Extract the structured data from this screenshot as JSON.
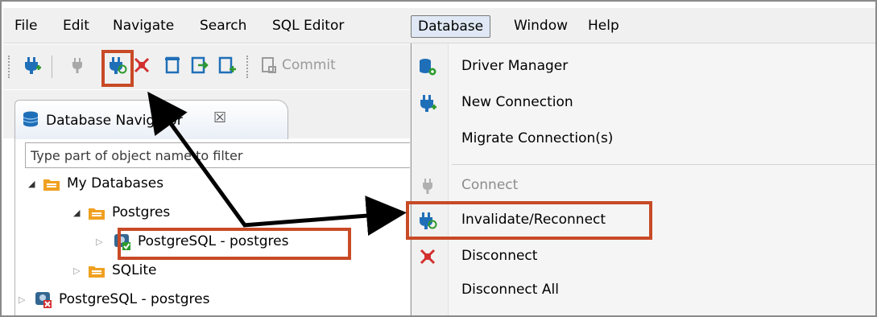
{
  "menubar": {
    "items": [
      "File",
      "Edit",
      "Navigate",
      "Search",
      "SQL Editor",
      "Database",
      "Window",
      "Help"
    ],
    "active": "Database"
  },
  "toolbar": {
    "commit_label": "Commit",
    "icons": [
      "new-connection-icon",
      "connect-icon",
      "invalidate-reconnect-icon",
      "disconnect-icon",
      "transaction-icon",
      "open-editor-icon",
      "new-editor-icon",
      "commit-icon"
    ]
  },
  "navigator": {
    "tab_label": "Database Navigator",
    "tab_close": "☒",
    "filter_placeholder": "Type part of object name to filter",
    "tree": {
      "my_databases": "My Databases",
      "postgres_folder": "Postgres",
      "postgres_conn": "PostgreSQL - postgres",
      "sqlite_folder": "SQLite",
      "postgres_conn_2": "PostgreSQL - postgres"
    }
  },
  "dropdown": {
    "items": [
      {
        "label": "Driver Manager",
        "icon": "driver-manager-icon",
        "enabled": true
      },
      {
        "label": "New Connection",
        "icon": "new-connection-icon",
        "enabled": true
      },
      {
        "label": "Migrate Connection(s)",
        "icon": "",
        "enabled": true
      },
      {
        "label": "Connect",
        "icon": "connect-icon",
        "enabled": false
      },
      {
        "label": "Invalidate/Reconnect",
        "icon": "invalidate-reconnect-icon",
        "enabled": true
      },
      {
        "label": "Disconnect",
        "icon": "disconnect-icon",
        "enabled": true
      },
      {
        "label": "Disconnect All",
        "icon": "",
        "enabled": true
      }
    ]
  },
  "colors": {
    "highlight_box": "#c84a26",
    "plug_blue": "#1f6fb8",
    "plug_red": "#d32f2f",
    "folder_orange": "#f0a020",
    "menu_active": "#dfe8f4"
  }
}
